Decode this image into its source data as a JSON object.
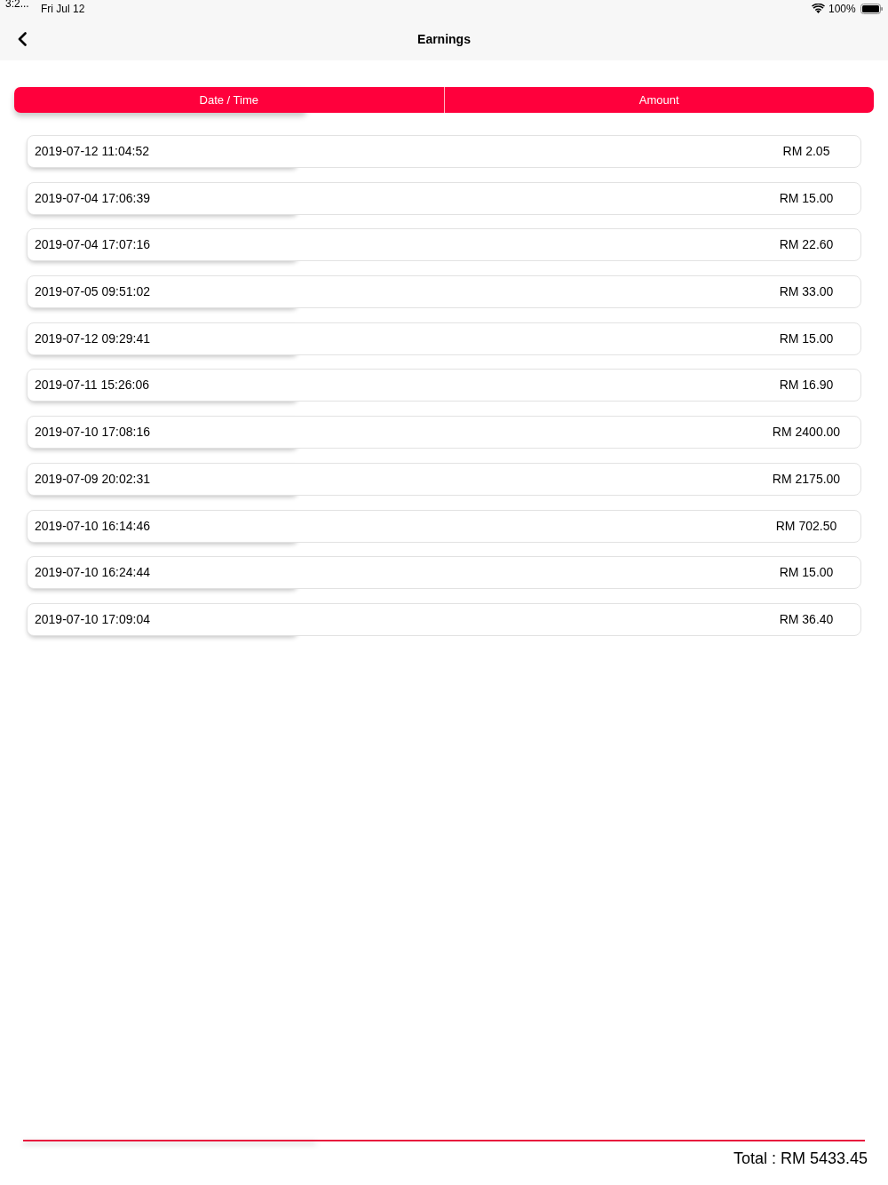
{
  "status_bar": {
    "time": "3:2...",
    "date": "Fri Jul 12",
    "battery": "100%"
  },
  "nav_bar": {
    "title": "Earnings"
  },
  "table": {
    "columns": [
      "Date / Time",
      "Amount"
    ],
    "rows": [
      {
        "date_time": "2019-07-12 11:04:52",
        "amount": "RM 2.05"
      },
      {
        "date_time": "2019-07-04 17:06:39",
        "amount": "RM 15.00"
      },
      {
        "date_time": "2019-07-04 17:07:16",
        "amount": "RM 22.60"
      },
      {
        "date_time": "2019-07-05 09:51:02",
        "amount": "RM 33.00"
      },
      {
        "date_time": "2019-07-12 09:29:41",
        "amount": "RM 15.00"
      },
      {
        "date_time": "2019-07-11 15:26:06",
        "amount": "RM 16.90"
      },
      {
        "date_time": "2019-07-10 17:08:16",
        "amount": "RM 2400.00"
      },
      {
        "date_time": "2019-07-09 20:02:31",
        "amount": "RM 2175.00"
      },
      {
        "date_time": "2019-07-10 16:14:46",
        "amount": "RM 702.50"
      },
      {
        "date_time": "2019-07-10 16:24:44",
        "amount": "RM 15.00"
      },
      {
        "date_time": "2019-07-10 17:09:04",
        "amount": "RM 36.40"
      }
    ]
  },
  "total": "Total : RM 5433.45"
}
